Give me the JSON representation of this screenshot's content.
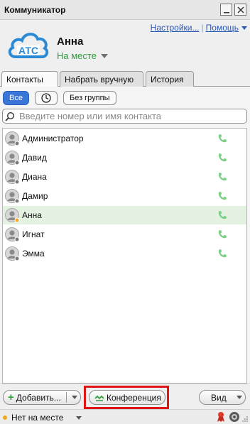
{
  "window": {
    "title": "Коммуникатор"
  },
  "header": {
    "logo_text": "АТС",
    "user_name": "Анна",
    "status": "На месте",
    "links": {
      "settings": "Настройки...",
      "help": "Помощь"
    }
  },
  "tabs": [
    {
      "label": "Контакты",
      "active": true
    },
    {
      "label": "Набрать вручную",
      "active": false
    },
    {
      "label": "История",
      "active": false
    }
  ],
  "filters": {
    "all": "Все",
    "no_group": "Без группы"
  },
  "search": {
    "placeholder": "Введите номер или имя контакта",
    "value": ""
  },
  "contacts": [
    {
      "name": "Администратор",
      "presence": "offline",
      "selected": false
    },
    {
      "name": "Давид",
      "presence": "offline",
      "selected": false
    },
    {
      "name": "Диана",
      "presence": "offline",
      "selected": false
    },
    {
      "name": "Дамир",
      "presence": "offline",
      "selected": false
    },
    {
      "name": "Анна",
      "presence": "away",
      "selected": true
    },
    {
      "name": "Игнат",
      "presence": "offline",
      "selected": false
    },
    {
      "name": "Эмма",
      "presence": "offline",
      "selected": false
    }
  ],
  "bottom": {
    "add": "Добавить...",
    "conference": "Конференция",
    "view": "Вид"
  },
  "statusbar": {
    "status": "Нет на месте"
  },
  "colors": {
    "accent": "#3a75d8",
    "presence_online": "#2e9e3b",
    "highlight": "#e01515",
    "away": "#f0a820",
    "phone": "#7ccf86"
  }
}
